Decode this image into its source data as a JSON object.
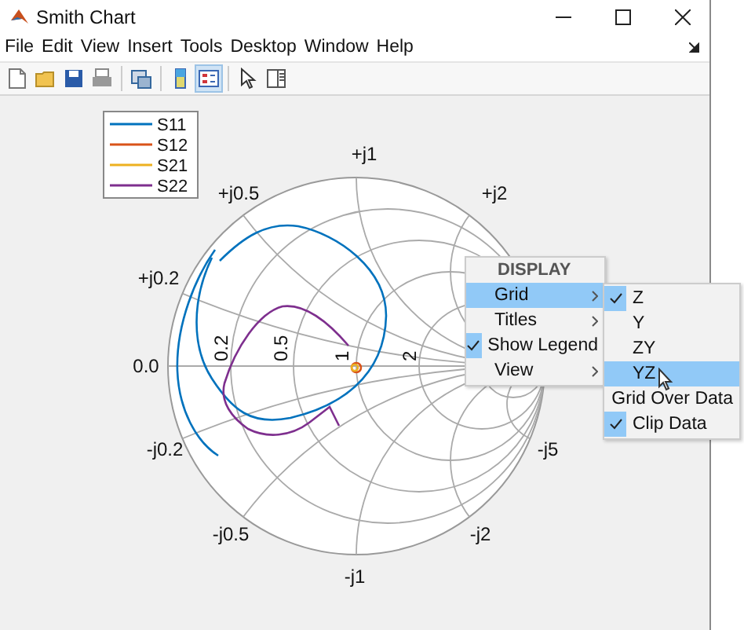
{
  "window": {
    "title": "Smith Chart"
  },
  "menu_bar": [
    "File",
    "Edit",
    "View",
    "Insert",
    "Tools",
    "Desktop",
    "Window",
    "Help"
  ],
  "toolbar": [
    {
      "kind": "new",
      "selected": false
    },
    {
      "kind": "open",
      "selected": false
    },
    {
      "kind": "save",
      "selected": false
    },
    {
      "kind": "print",
      "selected": false
    },
    {
      "kind": "separator"
    },
    {
      "kind": "link",
      "selected": false
    },
    {
      "kind": "separator"
    },
    {
      "kind": "colorbar",
      "selected": false
    },
    {
      "kind": "legend",
      "selected": true
    },
    {
      "kind": "separator"
    },
    {
      "kind": "pointer",
      "selected": false
    },
    {
      "kind": "inspector",
      "selected": false
    }
  ],
  "legend": {
    "items": [
      {
        "label": "S11",
        "color": "#0072bd"
      },
      {
        "label": "S12",
        "color": "#d95319"
      },
      {
        "label": "S21",
        "color": "#edb120"
      },
      {
        "label": "S22",
        "color": "#7e2f8e"
      }
    ]
  },
  "chart": {
    "reactance_labels": [
      "+j1",
      "+j0.5",
      "+j0.2",
      "0.0",
      "-j0.2",
      "-j0.5",
      "-j1",
      "-j2",
      "-j5",
      "+j2"
    ],
    "resistance_labels": [
      "0.2",
      "0.5",
      "1",
      "2"
    ]
  },
  "context_menu": {
    "header": "DISPLAY",
    "items": [
      {
        "label": "Grid",
        "has_submenu": true,
        "checked": false,
        "selected": true
      },
      {
        "label": "Titles",
        "has_submenu": true,
        "checked": false,
        "selected": false
      },
      {
        "label": "Show Legend",
        "has_submenu": false,
        "checked": true,
        "selected": false
      },
      {
        "label": "View",
        "has_submenu": true,
        "checked": false,
        "selected": false
      }
    ]
  },
  "submenu": {
    "items": [
      {
        "label": "Z",
        "checked": true,
        "selected": false
      },
      {
        "label": "Y",
        "checked": false,
        "selected": false
      },
      {
        "label": "ZY",
        "checked": false,
        "selected": false
      },
      {
        "label": "YZ",
        "checked": false,
        "selected": true
      },
      {
        "label": "Grid Over Data",
        "checked": false,
        "selected": false
      },
      {
        "label": "Clip Data",
        "checked": true,
        "selected": false
      }
    ]
  }
}
